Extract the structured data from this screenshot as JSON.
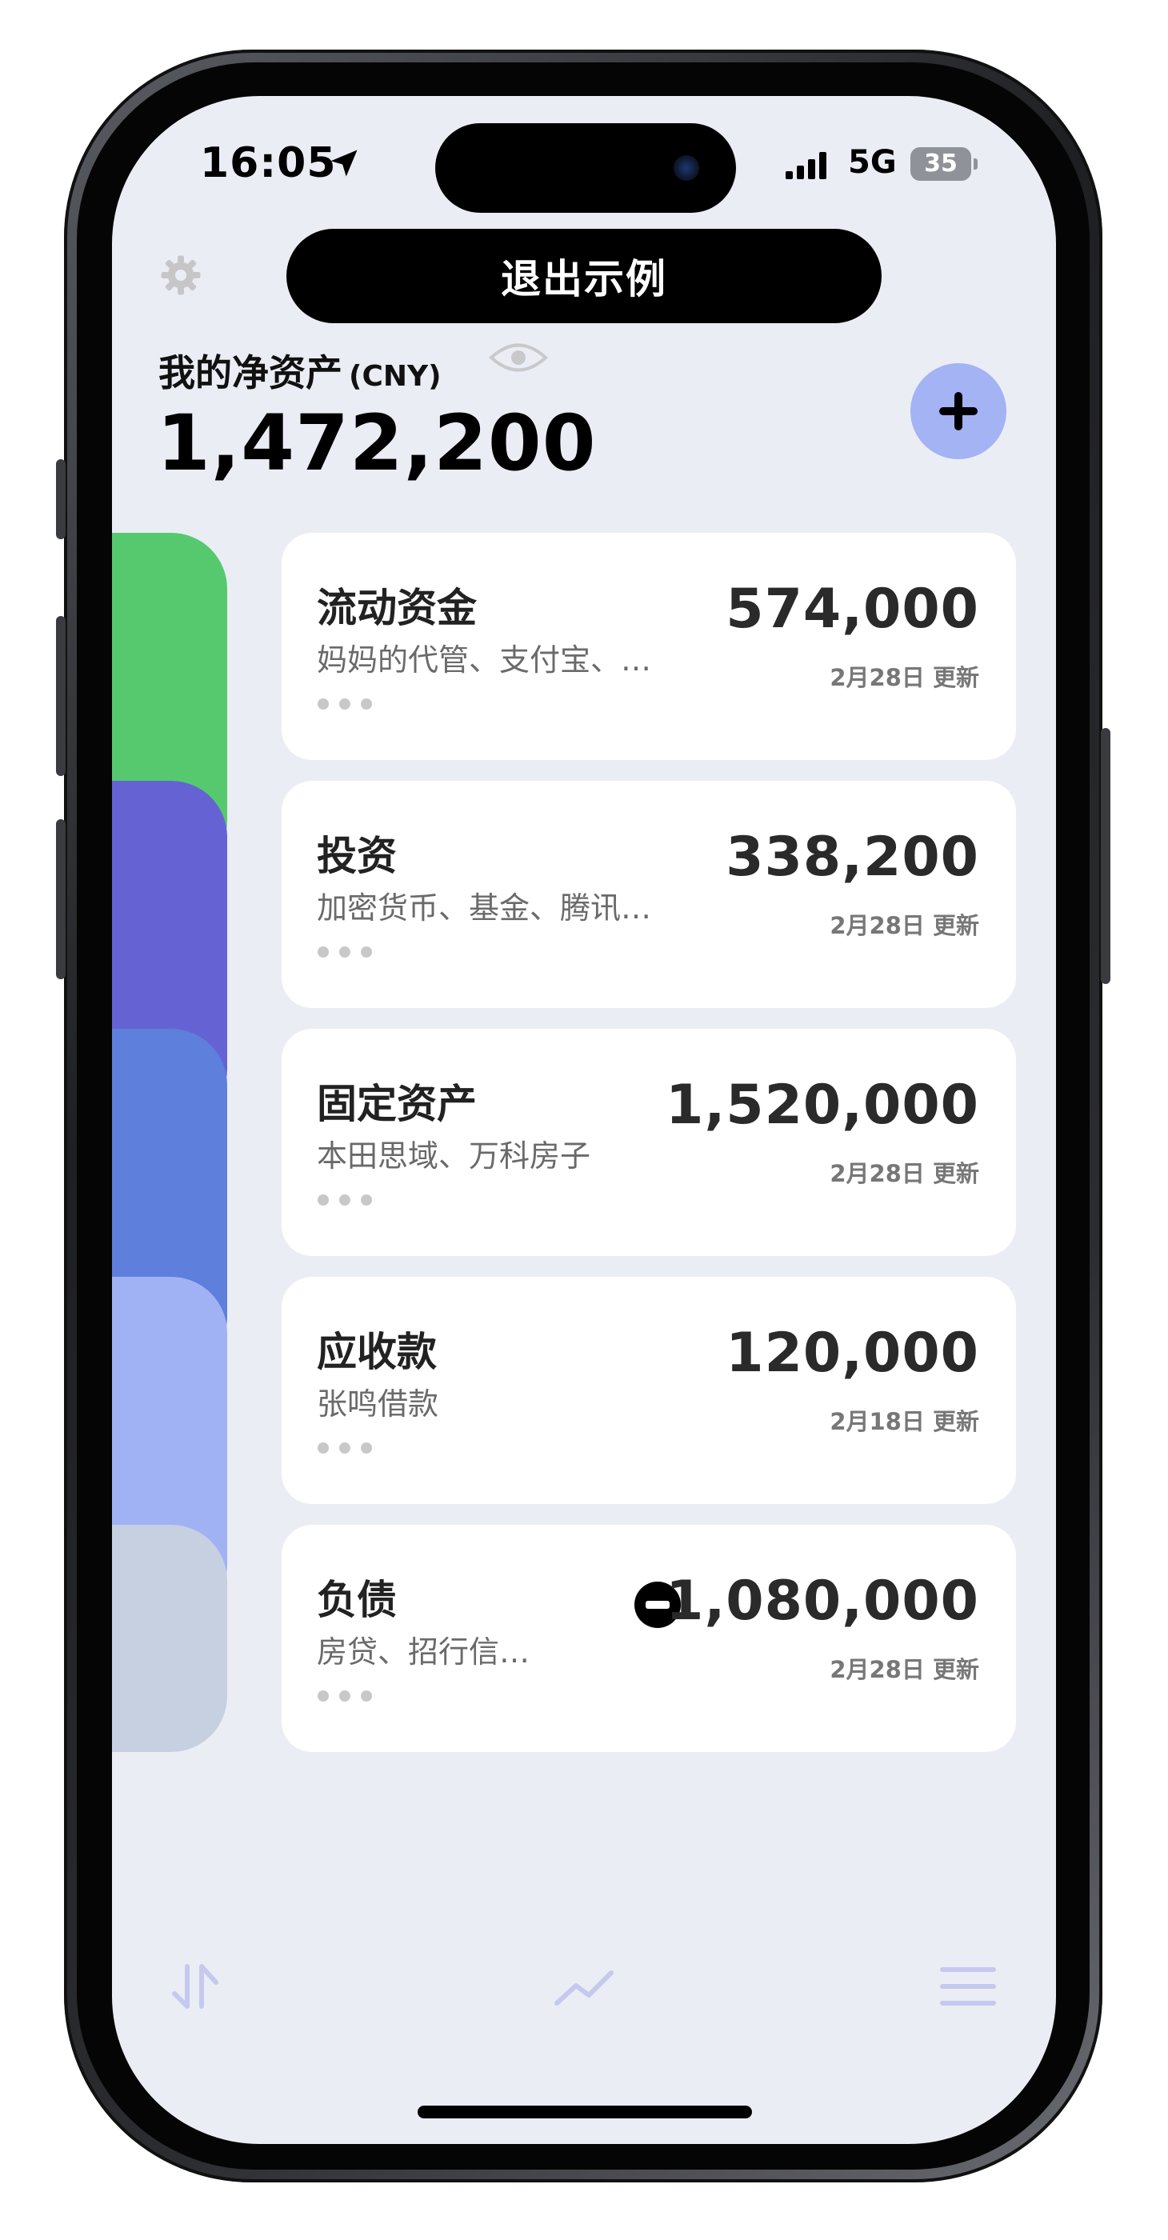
{
  "status_bar": {
    "time": "16:05",
    "network": "5G",
    "battery": "35"
  },
  "header": {
    "exit_button_label": "退出示例",
    "net_worth_label": "我的净资产",
    "currency": "(CNY)",
    "net_worth_value": "1,472,200"
  },
  "colors": {
    "tab_liquid": "#56c96f",
    "tab_investment": "#6563d4",
    "tab_fixed": "#5e7fdb",
    "tab_receivable": "#a0b2f4",
    "tab_liability": "#c6d0e0",
    "add_button": "#a3b3f4",
    "nav_icon": "#c5c9ee"
  },
  "cards": [
    {
      "title": "流动资金",
      "subtitle": "妈妈的代管、支付宝、…",
      "value": "574,000",
      "updated": "2月28日 更新"
    },
    {
      "title": "投资",
      "subtitle": "加密货币、基金、腾讯…",
      "value": "338,200",
      "updated": "2月28日 更新"
    },
    {
      "title": "固定资产",
      "subtitle": "本田思域、万科房子",
      "value": "1,520,000",
      "updated": "2月28日 更新"
    },
    {
      "title": "应收款",
      "subtitle": "张鸣借款",
      "value": "120,000",
      "updated": "2月18日 更新"
    },
    {
      "title": "负债",
      "subtitle": "房贷、招行信…",
      "value": "1,080,000",
      "updated": "2月28日 更新"
    }
  ],
  "bottom_nav": {
    "icons": [
      "sort-icon",
      "trend-chart-icon",
      "menu-icon"
    ]
  }
}
